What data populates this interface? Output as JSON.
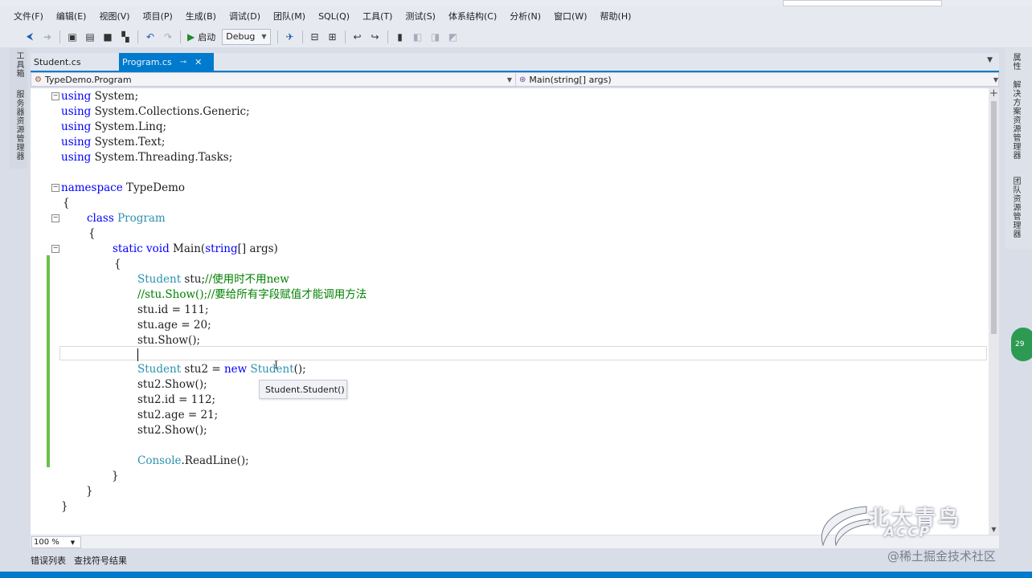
{
  "menu": [
    "文件(F)",
    "编辑(E)",
    "视图(V)",
    "项目(P)",
    "生成(B)",
    "调试(D)",
    "团队(M)",
    "SQL(Q)",
    "工具(T)",
    "测试(S)",
    "体系结构(C)",
    "分析(N)",
    "窗口(W)",
    "帮助(H)"
  ],
  "toolbar": {
    "start_label": "启动",
    "config_value": "Debug"
  },
  "left_dock": [
    "工具箱",
    "服务器资源管理器"
  ],
  "right_dock": [
    "属性",
    "解决方案资源管理器",
    "团队资源管理器"
  ],
  "tabs": [
    {
      "label": "Student.cs",
      "active": false
    },
    {
      "label": "Program.cs",
      "active": true
    }
  ],
  "navbar": {
    "type": "TypeDemo.Program",
    "member": "Main(string[] args)"
  },
  "code": {
    "l1": [
      "using",
      " System;"
    ],
    "l2": [
      "using",
      " System.Collections.Generic;"
    ],
    "l3": [
      "using",
      " System.Linq;"
    ],
    "l4": [
      "using",
      " System.Text;"
    ],
    "l5": [
      "using",
      " System.Threading.Tasks;"
    ],
    "l7": [
      "namespace",
      " TypeDemo"
    ],
    "l8": "{",
    "l9": [
      "class",
      "Program"
    ],
    "l10": "{",
    "l11": [
      "static",
      "void",
      " Main(",
      "string",
      "[] args)"
    ],
    "l12": "{",
    "l13": [
      "Student",
      " stu;",
      "//使用时不用new"
    ],
    "l14": "//stu.Show();//要给所有字段赋值才能调用方法",
    "l15": "stu.id = 111;",
    "l16": "stu.age = 20;",
    "l17": "stu.Show();",
    "l19": [
      "Student",
      " stu2 = ",
      "new",
      "Student",
      "();"
    ],
    "l20": "stu2.Show();",
    "l21": "stu2.id = 112;",
    "l22": "stu2.age = 21;",
    "l23": "stu2.Show();",
    "l25": [
      "Console",
      ".ReadLine();"
    ],
    "l26": "}",
    "l27": "}",
    "l28": "}"
  },
  "tooltip": "Student.Student()",
  "zoom": "100 %",
  "bottom_tabs": [
    "错误列表",
    "查找符号结果"
  ],
  "watermark": {
    "brand_cn": "北大青鸟",
    "brand_en": "ACCP",
    "site": "@稀土掘金技术社区"
  },
  "badge": "29"
}
